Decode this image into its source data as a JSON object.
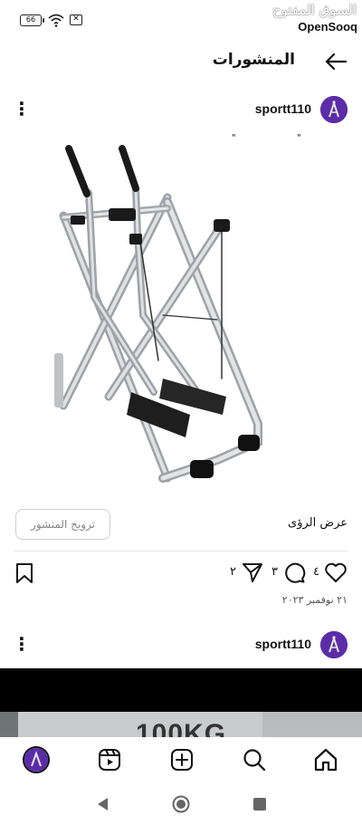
{
  "status_bar": {
    "battery": "66",
    "brand_arabic": "السوق المفتوح",
    "brand_english": "OpenSooq",
    "icons": [
      "battery-icon",
      "wifi-icon",
      "sim-off-icon"
    ]
  },
  "header": {
    "title": "المنشورات",
    "back_icon": "arrow-left-icon"
  },
  "posts": [
    {
      "username": "sportt110",
      "caption_dots": [
        "\"",
        "\""
      ],
      "image_subject": "silver air walker exercise machine",
      "view_insights": "عرض الرؤى",
      "promote_label": "ترويج المنشور",
      "likes": "٤",
      "comments": "٣",
      "shares": "٢",
      "date": "٢١ نوفمبر ٢٠٢٣"
    },
    {
      "username": "sportt110",
      "image_text": "100KG"
    }
  ],
  "tab_bar": [
    "profile-avatar",
    "reels-icon",
    "create-icon",
    "search-icon",
    "home-icon"
  ],
  "nav_bar": [
    "back-icon",
    "home-circle-icon",
    "recents-icon"
  ],
  "colors": {
    "accent_avatar": "#5b2ca8",
    "divider": "#e5e5e5"
  }
}
